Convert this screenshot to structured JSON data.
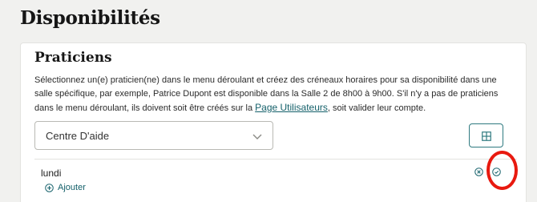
{
  "page": {
    "title": "Disponibilités"
  },
  "section": {
    "title": "Praticiens",
    "description_before": "Sélectionnez un(e) praticien(ne) dans le menu déroulant et créez des créneaux horaires pour sa disponibilité dans une salle spécifique, par exemple, Patrice Dupont est disponible dans la Salle 2 de 8h00 à 9h00. S'il n'y a pas de praticiens dans le menu déroulant, ils doivent soit être créés sur la ",
    "link_label": "Page Utilisateurs",
    "description_after": ", soit valider leur compte."
  },
  "practitioner_select": {
    "value": "Centre D'aide"
  },
  "schedule": {
    "day": "lundi",
    "add_label": "Ajouter"
  },
  "colors": {
    "accent": "#14606a",
    "highlight": "#e8190f",
    "background": "#f1f1ef"
  },
  "icons": {
    "select_chevron": "chevron-down-icon",
    "grid_button": "grid-icon",
    "add": "plus-circle-icon",
    "cancel": "close-circle-icon",
    "confirm": "check-circle-icon"
  }
}
